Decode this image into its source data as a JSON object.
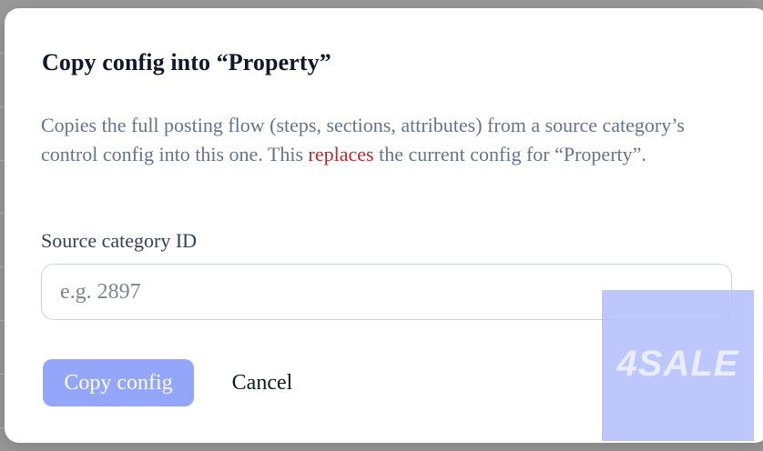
{
  "dialog": {
    "title": "Copy config into “Property”",
    "description": {
      "before": "Copies the full posting flow (steps, sections, attributes) from a source category’s control config into this one. This ",
      "highlight": "replaces",
      "after": " the current config for “Property”."
    },
    "field": {
      "label": "Source category ID",
      "value": "",
      "placeholder": "e.g. 2897"
    },
    "buttons": {
      "primary_label": "Copy config",
      "cancel_label": "Cancel"
    }
  },
  "watermark": {
    "text": "4SALE"
  },
  "colors": {
    "primary_button": "#94a6fa",
    "danger_text": "#c0262d",
    "description_text": "#64748b",
    "watermark_bg": "#b3bdfc"
  }
}
